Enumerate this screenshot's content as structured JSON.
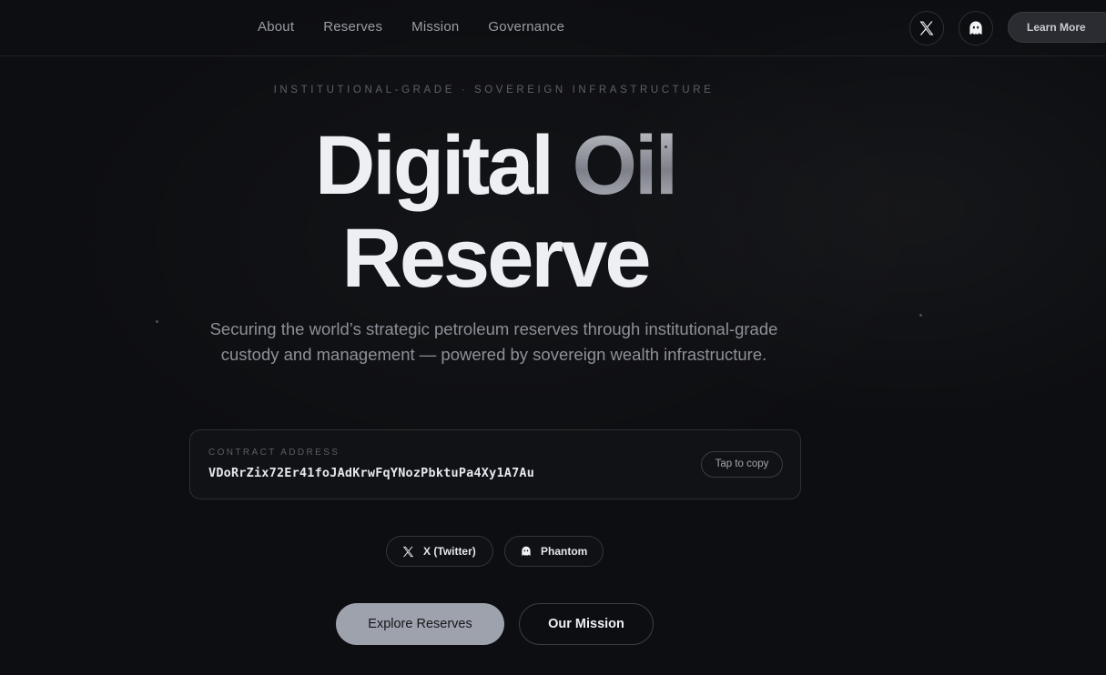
{
  "nav": {
    "links": [
      "About",
      "Reserves",
      "Mission",
      "Governance"
    ],
    "x_icon": "x-logo-icon",
    "phantom_icon": "phantom-ghost-icon",
    "learn_more": "Learn More"
  },
  "hero": {
    "eyebrow": "INSTITUTIONAL-GRADE · SOVEREIGN INFRASTRUCTURE",
    "title_part1": "Digital",
    "title_accent": "Oil",
    "title_line2": "Reserve",
    "subtitle": "Securing the world’s strategic petroleum reserves through institutional-grade custody and management — powered by sovereign wealth infrastructure."
  },
  "contract": {
    "label": "CONTRACT ADDRESS",
    "address": "VDoRrZix72Er41foJAdKrwFqYNozPbktuPa4Xy1A7Au",
    "copy_label": "Tap to copy"
  },
  "socials": {
    "twitter_label": "X (Twitter)",
    "phantom_label": "Phantom"
  },
  "cta": {
    "primary": "Explore Reserves",
    "secondary": "Our Mission"
  },
  "colors": {
    "background": "#0d0e11",
    "primary_button": "#9ea2ac",
    "text": "#eeeff3"
  }
}
